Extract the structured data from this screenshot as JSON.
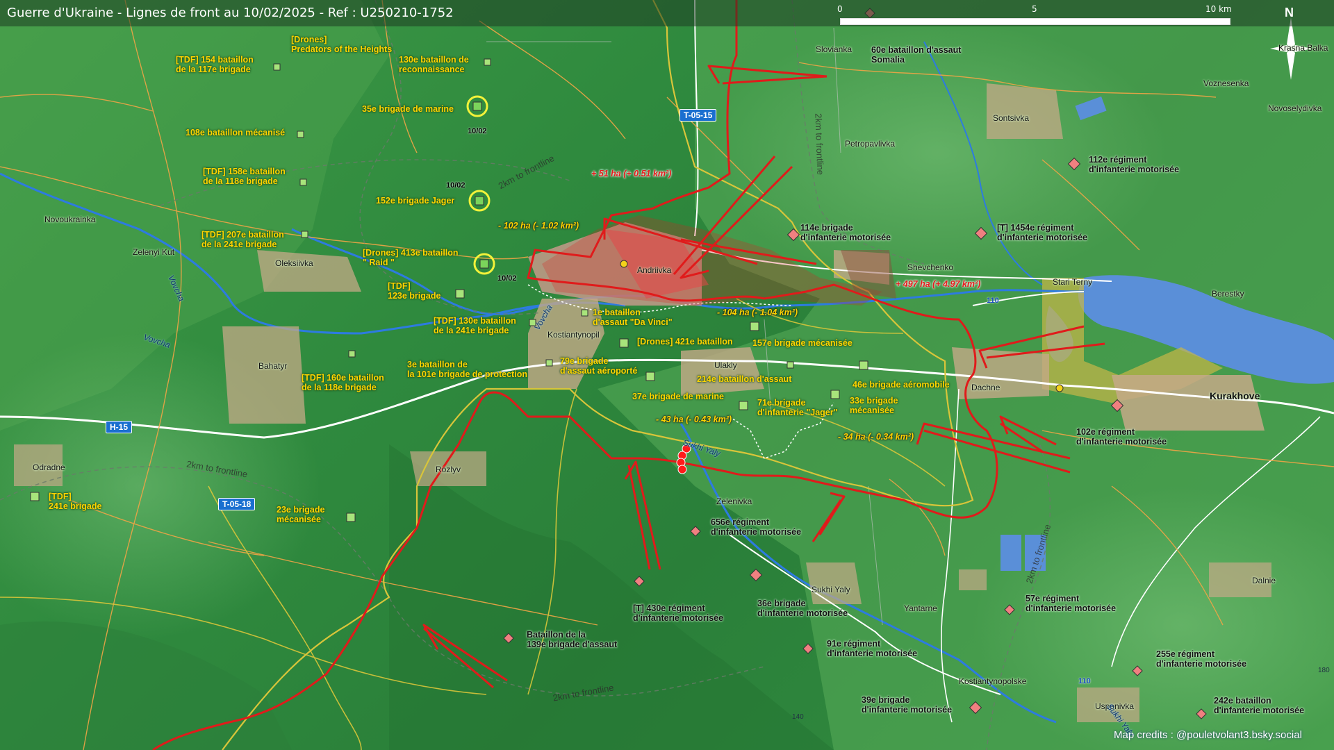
{
  "title": "Guerre d'Ukraine - Lignes de front au 10/02/2025 - Ref : U250210-1752",
  "scale": {
    "labels": [
      "0",
      "5",
      "10 km"
    ]
  },
  "north": "N",
  "credits": "Map credits : @pouletvolant3.bsky.social",
  "roads": [
    "T-05-15",
    "H-15",
    "T-05-18"
  ],
  "highway_refs": [
    "110",
    "110"
  ],
  "elevations": [
    "180",
    "140"
  ],
  "front_labels": [
    "2km to frontline",
    "2km to frontline",
    "2km to frontline",
    "2km to frontline",
    "2km to frontline"
  ],
  "places": {
    "andriivka": "Andriivka",
    "kostiantynopil": "Kostiantynopil",
    "ulakly": "Ulakly",
    "dachne": "Dachne",
    "kurakhove": "Kurakhove",
    "shevchenko": "Shevchenko",
    "stari_terny": "Stari Terny",
    "berestky": "Berestky",
    "slovianka": "Slovianka",
    "sontsivka": "Sontsivka",
    "petropavlivka": "Petropavlivka",
    "voznesenka": "Voznesenka",
    "novoselydivka": "Novoselydivka",
    "novoukrainka": "Novoukrainka",
    "zelenyi_kut": "Zelenyi Kut",
    "oleksiivka": "Oleksiivka",
    "bahatyr": "Bahatyr",
    "odradne": "Odradne",
    "rozlyv": "Rozlyv",
    "zelenivka": "Zelenivka",
    "sukhi_yaly": "Sukhi Yaly",
    "yantarne": "Yantarne",
    "kostiantynopolske": "Kostiantynopolske",
    "uspenivka": "Uspenivka",
    "dalnie": "Dalnie",
    "krasna_balka": "Krasna Balka"
  },
  "rivers": [
    "Vovcha",
    "Vovcha",
    "Vovcha",
    "Sukhi Yaly",
    "Sukhi Yaly"
  ],
  "ukrainian_units": [
    "[TDF] 154 bataillon\nde la 117e brigade",
    "[Drones]\nPredators of the Heights",
    "130e bataillon de\nreconnaissance",
    "35e brigade de marine",
    "108e bataillon mécanisé",
    "[TDF] 158e bataillon\nde la 118e brigade",
    "152e brigade Jager",
    "[TDF] 207e bataillon\nde la 241e brigade",
    "[Drones] 413e bataillon\n\" Raid \"",
    "[TDF]\n123e brigade",
    "[TDF] 130e bataillon\nde la 241e brigade",
    "1e bataillon\nd'assaut \"Da Vinci\"",
    "[Drones] 421e bataillon",
    "157e brigade mécanisée",
    "3e bataillon de\nla 101e brigade de protection",
    "79e brigade\nd'assaut aéroporté",
    "214e bataillon d'assaut",
    "46e brigade aéromobile",
    "[TDF] 160e bataillon\nde la 118e brigade",
    "37e brigade de marine",
    "71e brigade\nd'infanterie \"Jager\"",
    "33e brigade\nmécanisée",
    "[TDF]\n241e brigade",
    "23e brigade\nmécanisée"
  ],
  "russian_units": [
    "60e bataillon d'assaut\nSomalia",
    "112e régiment\nd'infanterie motorisée",
    "114e brigade\nd'infanterie motorisée",
    "[T] 1454e régiment\nd'infanterie motorisée",
    "102e régiment\nd'infanterie motorisée",
    "656e régiment\nd'infanterie motorisée",
    "[T] 430e régiment\nd'infanterie motorisée",
    "36e brigade\nd'infanterie motorisée",
    "57e régiment\nd'infanterie motorisée",
    "Bataillon de la\n139e brigade d'assaut",
    "91e régiment\nd'infanterie motorisée",
    "255e régiment\nd'infanterie motorisée",
    "39e brigade\nd'infanterie motorisée",
    "242e bataillon\nd'infanterie motorisée"
  ],
  "dates": [
    "10/02",
    "10/02",
    "10/02"
  ],
  "gains": [
    {
      "text": "+ 51 ha (+ 0.51 km²)",
      "side": "ru"
    },
    {
      "text": "- 102 ha (- 1.02 km²)",
      "side": "ua"
    },
    {
      "text": "+ 497 ha (+ 4.97 km²)",
      "side": "ru"
    },
    {
      "text": "- 104 ha (- 1.04 km²)",
      "side": "ua"
    },
    {
      "text": "- 43 ha (- 0.43 km²)",
      "side": "ua"
    },
    {
      "text": "- 34 ha (- 0.34 km²)",
      "side": "ua"
    }
  ],
  "colors": {
    "russian_front": "#e01b1b",
    "ukrainian_unit": "#ffd400",
    "russian_unit": "#f08080",
    "terrain": "#2f8a3e",
    "water": "#5a8fd8",
    "settlement": "#c4a987"
  }
}
